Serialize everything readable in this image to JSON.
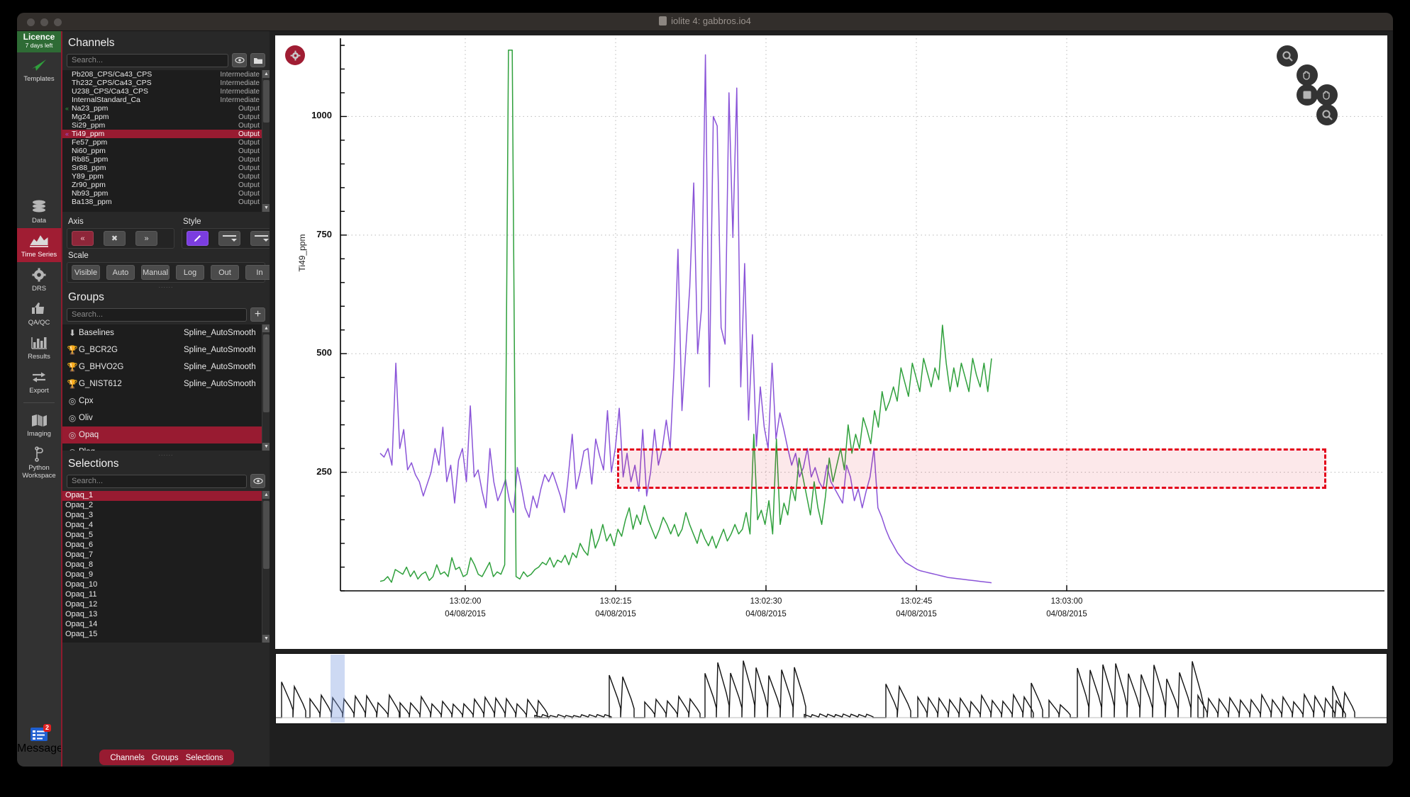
{
  "window": {
    "title": "iolite 4: gabbros.io4",
    "title_icon": "document-icon"
  },
  "rail": {
    "licence": {
      "line1": "Licence",
      "line2": "7 days left"
    },
    "templates_label": "Templates",
    "items": [
      {
        "label": "Data",
        "icon": "database-icon",
        "active": false
      },
      {
        "label": "Time Series",
        "icon": "timeseries-icon",
        "active": true
      },
      {
        "label": "DRS",
        "icon": "gear-icon",
        "active": false
      },
      {
        "label": "QA/QC",
        "icon": "thumbs-up-icon",
        "active": false
      },
      {
        "label": "Results",
        "icon": "bar-chart-icon",
        "active": false
      },
      {
        "label": "Export",
        "icon": "arrows-exchange-icon",
        "active": false
      },
      {
        "label": "Imaging",
        "icon": "map-icon",
        "active": false
      },
      {
        "label": "Python Workspace",
        "icon": "python-branch-icon",
        "active": false
      }
    ],
    "messages": {
      "label": "Messages",
      "badge": "2",
      "icon": "messages-icon"
    }
  },
  "channels": {
    "title": "Channels",
    "search_placeholder": "Search...",
    "eye_icon": "eye-icon",
    "folder_icon": "folder-icon",
    "rows": [
      {
        "name": "Pb208_CPS/Ca43_CPS",
        "type": "Intermediate",
        "marker": "",
        "selected": false
      },
      {
        "name": "Th232_CPS/Ca43_CPS",
        "type": "Intermediate",
        "marker": "",
        "selected": false
      },
      {
        "name": "U238_CPS/Ca43_CPS",
        "type": "Intermediate",
        "marker": "",
        "selected": false
      },
      {
        "name": "InternalStandard_Ca",
        "type": "Intermediate",
        "marker": "",
        "selected": false
      },
      {
        "name": "Na23_ppm",
        "type": "Output",
        "marker": "green",
        "selected": false
      },
      {
        "name": "Mg24_ppm",
        "type": "Output",
        "marker": "",
        "selected": false
      },
      {
        "name": "Si29_ppm",
        "type": "Output",
        "marker": "",
        "selected": false
      },
      {
        "name": "Ti49_ppm",
        "type": "Output",
        "marker": "purple",
        "selected": true
      },
      {
        "name": "Fe57_ppm",
        "type": "Output",
        "marker": "",
        "selected": false
      },
      {
        "name": "Ni60_ppm",
        "type": "Output",
        "marker": "",
        "selected": false
      },
      {
        "name": "Rb85_ppm",
        "type": "Output",
        "marker": "",
        "selected": false
      },
      {
        "name": "Sr88_ppm",
        "type": "Output",
        "marker": "",
        "selected": false
      },
      {
        "name": "Y89_ppm",
        "type": "Output",
        "marker": "",
        "selected": false
      },
      {
        "name": "Zr90_ppm",
        "type": "Output",
        "marker": "",
        "selected": false
      },
      {
        "name": "Nb93_ppm",
        "type": "Output",
        "marker": "",
        "selected": false
      },
      {
        "name": "Ba138_ppm",
        "type": "Output",
        "marker": "",
        "selected": false
      }
    ]
  },
  "axis": {
    "label": "Axis",
    "prev_label": "«",
    "close_label": "✖",
    "next_label": "»"
  },
  "style": {
    "label": "Style",
    "color_icon": "pen-icon",
    "line_style_icon": "line-style-dropdown-icon",
    "line_width_icon": "line-width-dropdown-icon"
  },
  "scale": {
    "label": "Scale",
    "buttons": [
      "Visible",
      "Auto",
      "Manual",
      "Log",
      "Out",
      "In"
    ]
  },
  "groups": {
    "title": "Groups",
    "search_placeholder": "Search...",
    "add_label": "+",
    "rows": [
      {
        "name": "Baselines",
        "spline": "Spline_AutoSmooth",
        "icon": "down-arrow-icon",
        "selected": false
      },
      {
        "name": "G_BCR2G",
        "spline": "Spline_AutoSmooth",
        "icon": "trophy-icon",
        "selected": false
      },
      {
        "name": "G_BHVO2G",
        "spline": "Spline_AutoSmooth",
        "icon": "trophy-icon",
        "selected": false
      },
      {
        "name": "G_NIST612",
        "spline": "Spline_AutoSmooth",
        "icon": "trophy-icon",
        "selected": false
      },
      {
        "name": "Cpx",
        "spline": "",
        "icon": "target-icon",
        "selected": false
      },
      {
        "name": "Oliv",
        "spline": "",
        "icon": "target-icon",
        "selected": false
      },
      {
        "name": "Opaq",
        "spline": "",
        "icon": "target-icon",
        "selected": true
      },
      {
        "name": "Plag",
        "spline": "",
        "icon": "target-icon",
        "selected": false
      }
    ]
  },
  "selections": {
    "title": "Selections",
    "search_placeholder": "Search...",
    "eye_icon": "eye-icon",
    "rows": [
      {
        "name": "Opaq_1",
        "selected": true
      },
      {
        "name": "Opaq_2",
        "selected": false
      },
      {
        "name": "Opaq_3",
        "selected": false
      },
      {
        "name": "Opaq_4",
        "selected": false
      },
      {
        "name": "Opaq_5",
        "selected": false
      },
      {
        "name": "Opaq_6",
        "selected": false
      },
      {
        "name": "Opaq_7",
        "selected": false
      },
      {
        "name": "Opaq_8",
        "selected": false
      },
      {
        "name": "Opaq_9",
        "selected": false
      },
      {
        "name": "Opaq_10",
        "selected": false
      },
      {
        "name": "Opaq_11",
        "selected": false
      },
      {
        "name": "Opaq_12",
        "selected": false
      },
      {
        "name": "Opaq_13",
        "selected": false
      },
      {
        "name": "Opaq_14",
        "selected": false
      },
      {
        "name": "Opaq_15",
        "selected": false
      }
    ]
  },
  "bottom_tabs": [
    "Channels",
    "Groups",
    "Selections"
  ],
  "plot_toolbar": {
    "settings_icon": "gear-icon",
    "buttons": [
      {
        "icon": "zoom-icon",
        "name": "zoom-tool-top-left"
      },
      {
        "icon": "pan-hand-icon",
        "name": "pan-tool-top-right"
      },
      {
        "icon": "rect-select-icon",
        "name": "rect-select-tool"
      },
      {
        "icon": "pan-hand-icon",
        "name": "pan-tool-mid-right"
      },
      {
        "icon": "zoom-icon",
        "name": "zoom-tool-bottom"
      }
    ]
  },
  "chart_data": {
    "type": "line",
    "title": "",
    "ylabel": "Ti49_ppm",
    "xlabel": "",
    "ylim": [
      0,
      1150
    ],
    "yticks": [
      250,
      500,
      750,
      1000
    ],
    "yminor_count": 4,
    "grid": true,
    "xlim_labels": [
      "13:02:00",
      "13:02:15",
      "13:02:30",
      "13:02:45",
      "13:03:00"
    ],
    "xdate": "04/08/2015",
    "xticks": [
      {
        "time": "13:02:00",
        "date": "04/08/2015"
      },
      {
        "time": "13:02:15",
        "date": "04/08/2015"
      },
      {
        "time": "13:02:30",
        "date": "04/08/2015"
      },
      {
        "time": "13:02:45",
        "date": "04/08/2015"
      },
      {
        "time": "13:03:00",
        "date": "04/08/2015"
      }
    ],
    "selection_band": {
      "y_low": 215,
      "y_high": 300,
      "x_start_pct": 16.5,
      "x_end_pct": 97.0,
      "color": "#e3001b"
    },
    "series": [
      {
        "name": "Ti49_ppm",
        "color": "#8a54d8",
        "values": [
          290,
          282,
          300,
          265,
          480,
          300,
          340,
          255,
          270,
          245,
          230,
          200,
          225,
          250,
          300,
          265,
          345,
          230,
          265,
          185,
          275,
          300,
          230,
          390,
          240,
          255,
          210,
          175,
          300,
          230,
          190,
          210,
          235,
          190,
          165,
          260,
          220,
          175,
          155,
          200,
          175,
          215,
          245,
          230,
          250,
          225,
          200,
          165,
          240,
          330,
          215,
          250,
          295,
          300,
          225,
          320,
          285,
          255,
          380,
          250,
          300,
          385,
          240,
          290,
          230,
          265,
          210,
          340,
          200,
          250,
          340,
          265,
          300,
          360,
          300,
          470,
          720,
          380,
          510,
          640,
          860,
          500,
          595,
          1130,
          430,
          1000,
          980,
          555,
          520,
          1050,
          745,
          1060,
          430,
          690,
          360,
          540,
          305,
          430,
          345,
          300,
          480,
          320,
          375,
          340,
          300,
          265,
          290,
          240,
          260,
          300,
          240,
          260,
          230,
          215,
          265,
          230,
          215,
          200,
          185,
          265,
          240,
          190,
          215,
          175,
          210,
          240,
          300,
          175,
          155,
          130,
          110,
          95,
          80,
          70,
          60,
          55,
          50,
          45,
          42,
          40,
          38,
          36,
          34,
          32,
          30,
          28,
          27,
          26,
          25,
          24,
          23,
          22,
          21,
          20,
          19,
          18,
          17
        ]
      },
      {
        "name": "Na23_ppm",
        "color": "#2fa03c",
        "values": [
          20,
          22,
          30,
          18,
          45,
          40,
          35,
          50,
          30,
          42,
          25,
          35,
          40,
          22,
          30,
          55,
          35,
          40,
          30,
          70,
          45,
          50,
          30,
          35,
          70,
          55,
          35,
          30,
          45,
          60,
          30,
          40,
          35,
          55,
          1140,
          1140,
          30,
          25,
          40,
          30,
          35,
          45,
          50,
          60,
          55,
          70,
          50,
          65,
          60,
          75,
          55,
          80,
          70,
          100,
          85,
          75,
          130,
          90,
          110,
          140,
          105,
          120,
          95,
          130,
          115,
          150,
          175,
          130,
          160,
          140,
          180,
          150,
          130,
          110,
          130,
          155,
          140,
          120,
          140,
          115,
          130,
          165,
          140,
          120,
          100,
          130,
          110,
          95,
          115,
          90,
          110,
          130,
          105,
          120,
          140,
          120,
          130,
          165,
          120,
          330,
          150,
          170,
          140,
          190,
          120,
          320,
          140,
          185,
          160,
          220,
          190,
          280,
          240,
          200,
          160,
          230,
          175,
          140,
          200,
          280,
          230,
          265,
          300,
          255,
          350,
          290,
          330,
          300,
          365,
          340,
          310,
          380,
          345,
          420,
          380,
          400,
          430,
          400,
          470,
          440,
          410,
          480,
          450,
          420,
          490,
          460,
          430,
          470,
          445,
          560,
          480,
          420,
          470,
          430,
          480,
          450,
          420,
          490,
          455,
          430,
          480,
          420,
          490
        ]
      }
    ]
  },
  "navigator": {
    "selection_highlight_pct": {
      "left": 4.9,
      "width": 1.3
    },
    "trace_color": "#111111"
  }
}
